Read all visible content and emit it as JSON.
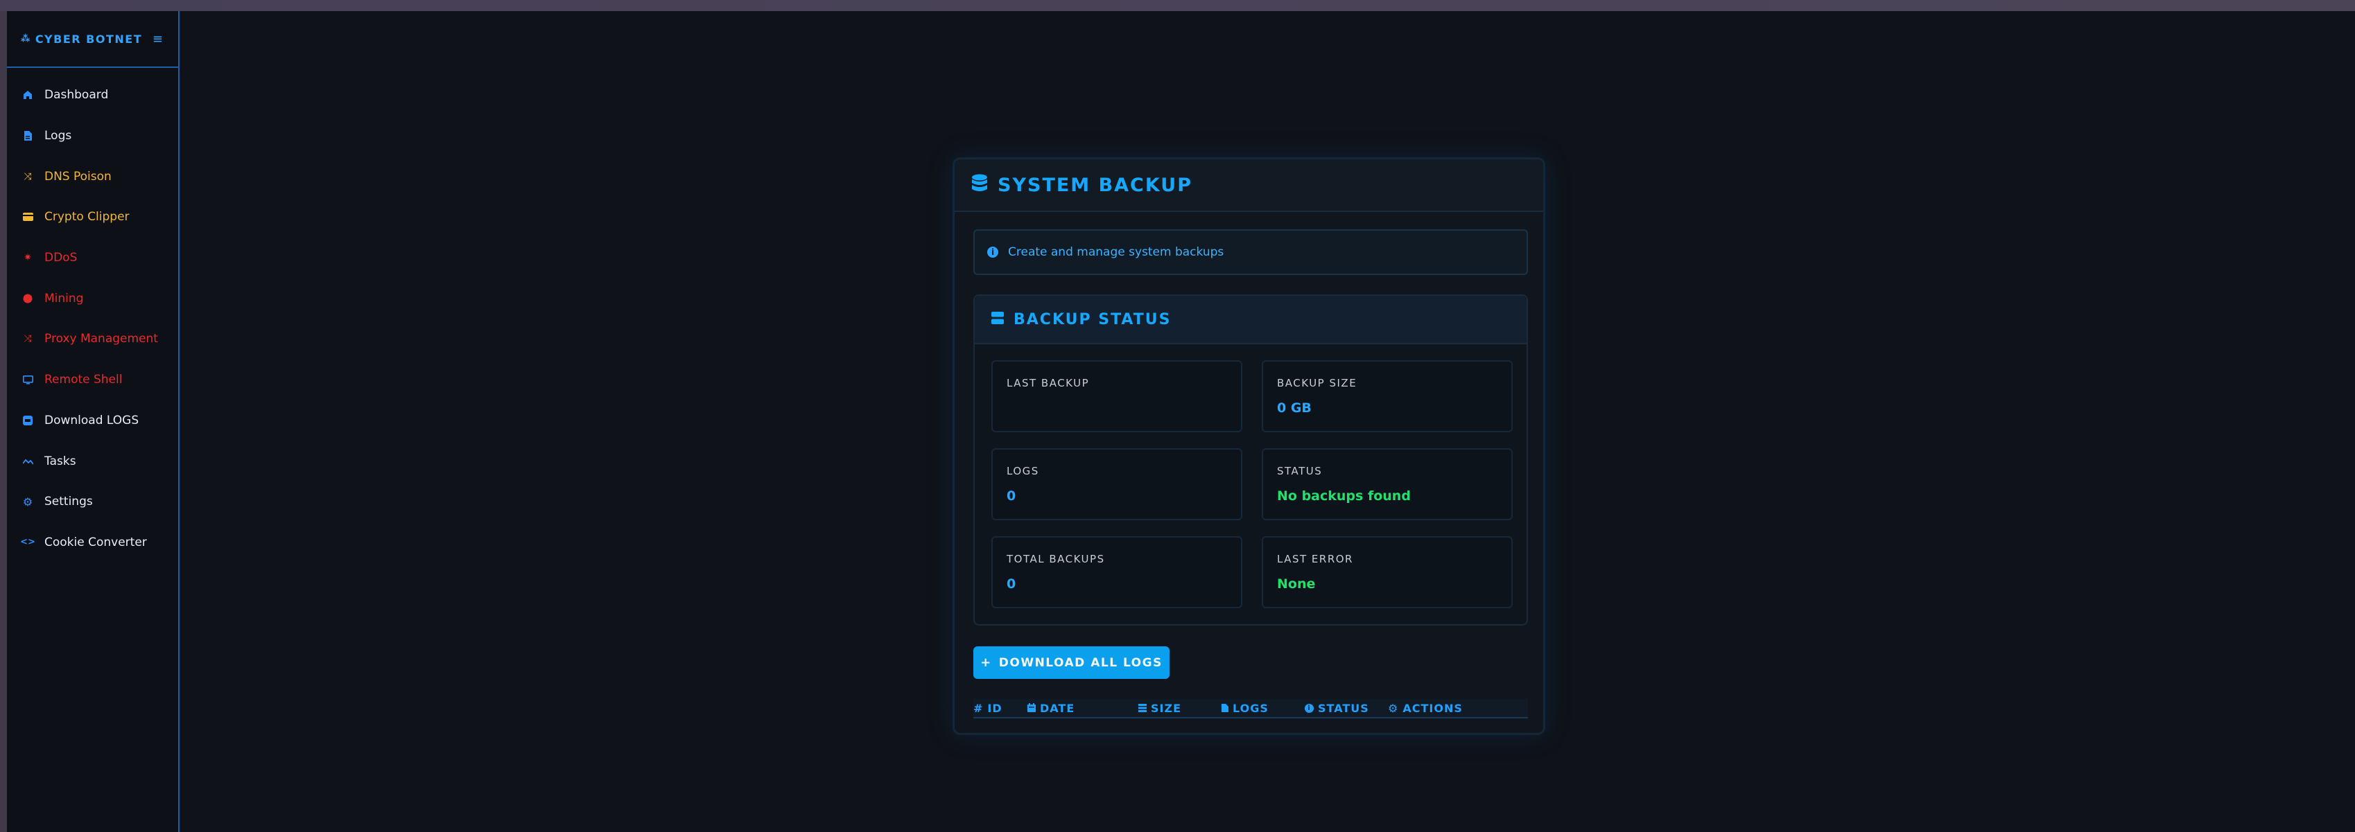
{
  "sidebar": {
    "brand": "CYBER BOTNET",
    "toggle_icon": "≡",
    "items": [
      {
        "label": "Dashboard",
        "icon": "home-icon",
        "color": "#e8edf4"
      },
      {
        "label": "Logs",
        "icon": "file-icon",
        "color": "#e8edf4"
      },
      {
        "label": "DNS Poison",
        "icon": "shuffle-icon",
        "color": "#f2b632"
      },
      {
        "label": "Crypto Clipper",
        "icon": "card-icon",
        "color": "#f2b632"
      },
      {
        "label": "DDoS",
        "icon": "bolt-icon",
        "color": "#e52b2b"
      },
      {
        "label": "Mining",
        "icon": "circle-icon",
        "color": "#e52b2b"
      },
      {
        "label": "Proxy Management",
        "icon": "shuffle-icon",
        "color": "#e52b2b"
      },
      {
        "label": "Remote Shell",
        "icon": "monitor-icon",
        "color": "#e52b2b"
      },
      {
        "label": "Download LOGS",
        "icon": "download-icon",
        "color": "#e8edf4"
      },
      {
        "label": "Tasks",
        "icon": "chart-icon",
        "color": "#e8edf4"
      },
      {
        "label": "Settings",
        "icon": "gear-icon",
        "color": "#e8edf4"
      },
      {
        "label": "Cookie Converter",
        "icon": "code-icon",
        "color": "#e8edf4"
      }
    ]
  },
  "card": {
    "title": "SYSTEM BACKUP",
    "info": "Create and manage system backups",
    "status_title": "BACKUP STATUS",
    "stats": [
      {
        "label": "LAST BACKUP",
        "value": "",
        "color": "#28a8ff"
      },
      {
        "label": "BACKUP SIZE",
        "value": "0 GB",
        "color": "#28a8ff"
      },
      {
        "label": "LOGS",
        "value": "0",
        "color": "#28a8ff"
      },
      {
        "label": "STATUS",
        "value": "No backups found",
        "color": "#22e06c"
      },
      {
        "label": "TOTAL BACKUPS",
        "value": "0",
        "color": "#28a8ff"
      },
      {
        "label": "LAST ERROR",
        "value": "None",
        "color": "#22e06c"
      }
    ],
    "download_button": "DOWNLOAD ALL LOGS",
    "table_headers": [
      {
        "label": "ID",
        "icon": "hash-icon"
      },
      {
        "label": "DATE",
        "icon": "calendar-icon"
      },
      {
        "label": "SIZE",
        "icon": "database-icon"
      },
      {
        "label": "LOGS",
        "icon": "file-icon"
      },
      {
        "label": "STATUS",
        "icon": "info-icon"
      },
      {
        "label": "ACTIONS",
        "icon": "gear-icon"
      }
    ]
  }
}
